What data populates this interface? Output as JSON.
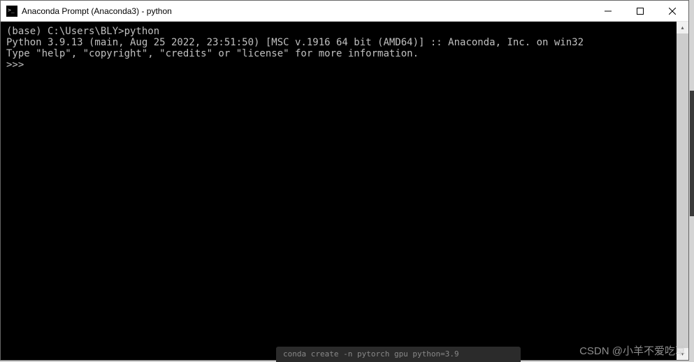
{
  "window": {
    "title": "Anaconda Prompt (Anaconda3) - python"
  },
  "terminal": {
    "line1": "(base) C:\\Users\\BLY>python",
    "line2": "Python 3.9.13 (main, Aug 25 2022, 23:51:50) [MSC v.1916 64 bit (AMD64)] :: Anaconda, Inc. on win32",
    "line3": "Type \"help\", \"copyright\", \"credits\" or \"license\" for more information.",
    "prompt": ">>> "
  },
  "watermark": "CSDN @小羊不爱吃草",
  "taskbar_fragment": "conda create -n pytorch gpu python=3.9"
}
